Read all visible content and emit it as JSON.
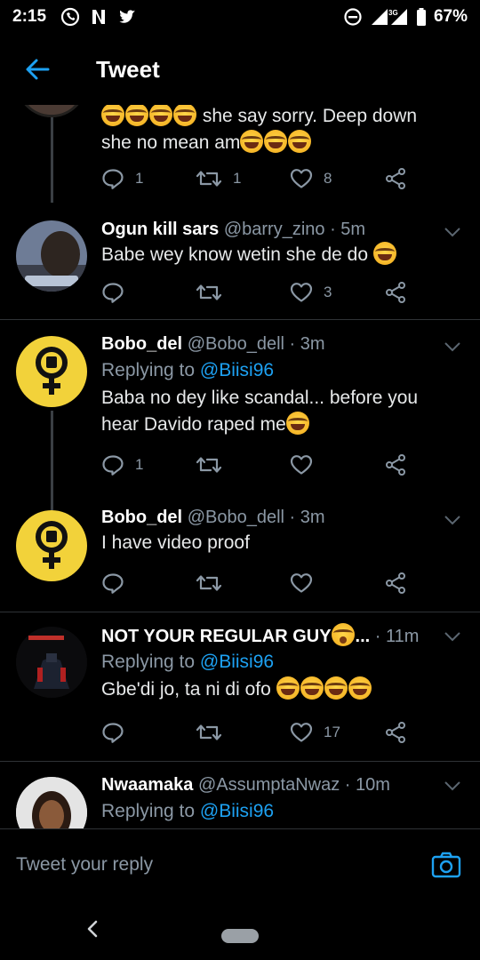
{
  "status_bar": {
    "time": "2:15",
    "network": "3G",
    "battery": "67%"
  },
  "header": {
    "title": "Tweet",
    "back_icon": "arrow-left-icon"
  },
  "colors": {
    "accent": "#1da1f2",
    "muted": "#8b98a5",
    "background": "#000000"
  },
  "tweets": [
    {
      "text_line1": " she say sorry. Deep down",
      "text_line2": "she no mean am",
      "replies": "1",
      "retweets": "1",
      "likes": "8"
    },
    {
      "name": "Ogun kill sars",
      "handle": "@barry_zino · 5m",
      "text": "Babe wey know wetin she de do ",
      "replies": "",
      "retweets": "",
      "likes": "3"
    },
    {
      "name": "Bobo_del",
      "handle": "@Bobo_dell · 3m",
      "replying_prefix": "Replying to ",
      "replying_to": "@Biisi96",
      "text_line1": "Baba no dey like scandal... before you",
      "text_line2": "hear Davido raped me",
      "replies": "1",
      "retweets": "",
      "likes": ""
    },
    {
      "name": "Bobo_del",
      "handle": "@Bobo_dell · 3m",
      "text": "I have video proof",
      "replies": "",
      "retweets": "",
      "likes": ""
    },
    {
      "name": "NOT YOUR REGULAR GUY",
      "name_suffix": "...",
      "handle": " · 11m",
      "replying_prefix": "Replying to ",
      "replying_to": "@Biisi96",
      "text": "Gbe'di jo, ta ni di ofo ",
      "replies": "",
      "retweets": "",
      "likes": "17"
    },
    {
      "name": "Nwaamaka",
      "handle": "@AssumptaNwaz · 10m",
      "replying_prefix": "Replying to ",
      "replying_to": "@Biisi96"
    }
  ],
  "reply_bar": {
    "placeholder": "Tweet your reply"
  }
}
